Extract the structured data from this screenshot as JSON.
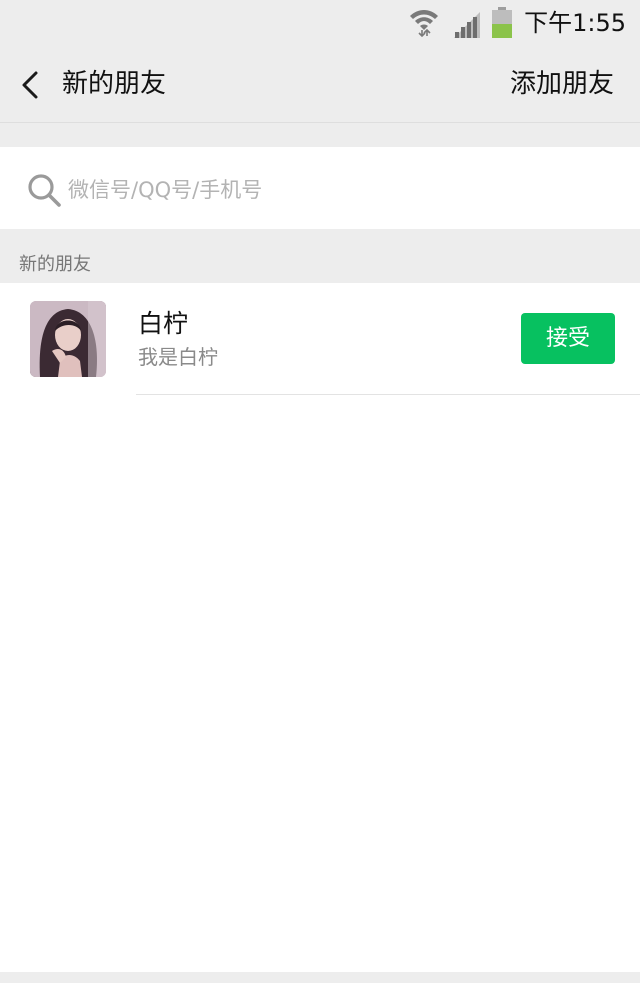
{
  "status_bar": {
    "time": "下午1:55",
    "icons": [
      "wifi-icon",
      "signal-icon",
      "battery-icon"
    ],
    "battery_color": "#8bc34a"
  },
  "nav": {
    "title": "新的朋友",
    "action": "添加朋友",
    "back_icon": "chevron-left-icon"
  },
  "search": {
    "placeholder": "微信号/QQ号/手机号",
    "icon": "search-icon"
  },
  "section": {
    "header": "新的朋友"
  },
  "requests": [
    {
      "name": "白柠",
      "message": "我是白柠",
      "button_label": "接受",
      "button_color": "#07c160"
    }
  ]
}
